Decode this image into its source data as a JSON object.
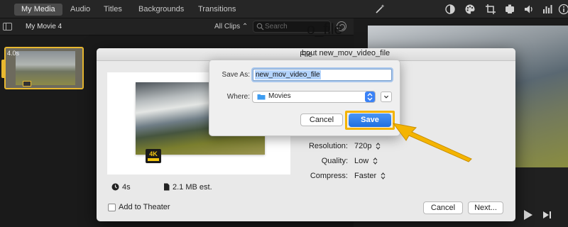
{
  "toolbar": {
    "tabs": [
      {
        "label": "My Media",
        "active": true
      },
      {
        "label": "Audio",
        "active": false
      },
      {
        "label": "Titles",
        "active": false
      },
      {
        "label": "Backgrounds",
        "active": false
      },
      {
        "label": "Transitions",
        "active": false
      }
    ],
    "right_icons": [
      "magic-wand-icon",
      "color-balance-icon",
      "palette-icon",
      "crop-icon",
      "camera-icon",
      "volume-icon",
      "equalizer-icon",
      "info-icon"
    ]
  },
  "library": {
    "project_name": "My Movie 4",
    "filter": "All Clips",
    "search_placeholder": "Search",
    "clip_duration": "4.0s"
  },
  "share_sheet": {
    "title": "File",
    "video_title": "o_file",
    "video_description": "bout new_mov_video_file",
    "duration": "4s",
    "size": "2.1 MB est.",
    "badge": "4K",
    "options": [
      {
        "label": "Resolution:",
        "value": "720p"
      },
      {
        "label": "Quality:",
        "value": "Low"
      },
      {
        "label": "Compress:",
        "value": "Faster"
      }
    ],
    "add_to_theater": "Add to Theater",
    "add_to_theater_checked": false,
    "cancel_label": "Cancel",
    "next_label": "Next..."
  },
  "save_dialog": {
    "save_as_label": "Save As:",
    "save_as_value": "new_mov_video_file",
    "where_label": "Where:",
    "where_value": "Movies",
    "cancel_label": "Cancel",
    "save_label": "Save"
  },
  "colors": {
    "highlight": "#f4b400",
    "accent_blue": "#1f6fe0",
    "clip_selection": "#e8b830"
  }
}
